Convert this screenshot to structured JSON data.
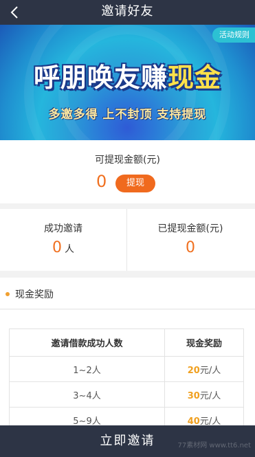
{
  "header": {
    "title": "邀请好友",
    "back_icon": "chevron-left-icon"
  },
  "banner": {
    "rules_label": "活动规则",
    "headline_part1": "呼朋唤友赚",
    "headline_part2": "现金",
    "subline": "多邀多得  上不封顶  支持提现"
  },
  "withdraw": {
    "label": "可提现金额(元)",
    "amount": "0",
    "button_label": "提现"
  },
  "stats": {
    "invited_label": "成功邀请",
    "invited_value": "0",
    "invited_unit": "人",
    "withdrawn_label": "已提现金额(元)",
    "withdrawn_value": "0"
  },
  "reward": {
    "title": "现金奖励",
    "table": {
      "headers": [
        "邀请借款成功人数",
        "现金奖励"
      ],
      "rows": [
        {
          "range": "1~2人",
          "amount": "20",
          "unit": "元/人"
        },
        {
          "range": "3~4人",
          "amount": "30",
          "unit": "元/人"
        },
        {
          "range": "5~9人",
          "amount": "40",
          "unit": "元/人"
        }
      ]
    }
  },
  "bottom_button_label": "立即邀请",
  "watermark": "77素材网 www.tt6.net",
  "colors": {
    "header_bg": "#2d3445",
    "accent_orange": "#f06a1e",
    "reward_gold": "#f0a020"
  }
}
